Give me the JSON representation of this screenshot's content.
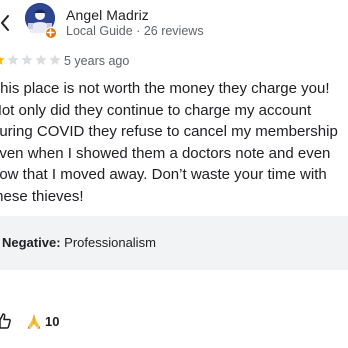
{
  "header": {
    "back_icon": "chevron-left-icon",
    "author_name": "Angel Madriz",
    "author_meta": "Local Guide · 26 reviews",
    "badge_icon": "local-guide-badge-icon"
  },
  "review": {
    "rating": 1,
    "rating_max": 5,
    "time_ago": "5 years ago",
    "lines": [
      "This place is not worth the money they charge you!",
      "Not only did they continue to charge my account",
      "during COVID they refuse to cancel my membership",
      "even when I showed them a doctors note and even",
      "now that I moved away. Don’t waste your time with",
      "these thieves!"
    ]
  },
  "attributes": {
    "label": "Negative:",
    "value": " Professionalism"
  },
  "footer": {
    "like_icon": "thumbs-up-icon",
    "reaction_icon": "folded-hands-emoji",
    "reaction_count": "10"
  },
  "colors": {
    "text": "#202124",
    "secondary": "#5f6368",
    "attr_bg": "#f1f3f4",
    "badge": "#e8710a",
    "star_off": "#dadce0"
  }
}
